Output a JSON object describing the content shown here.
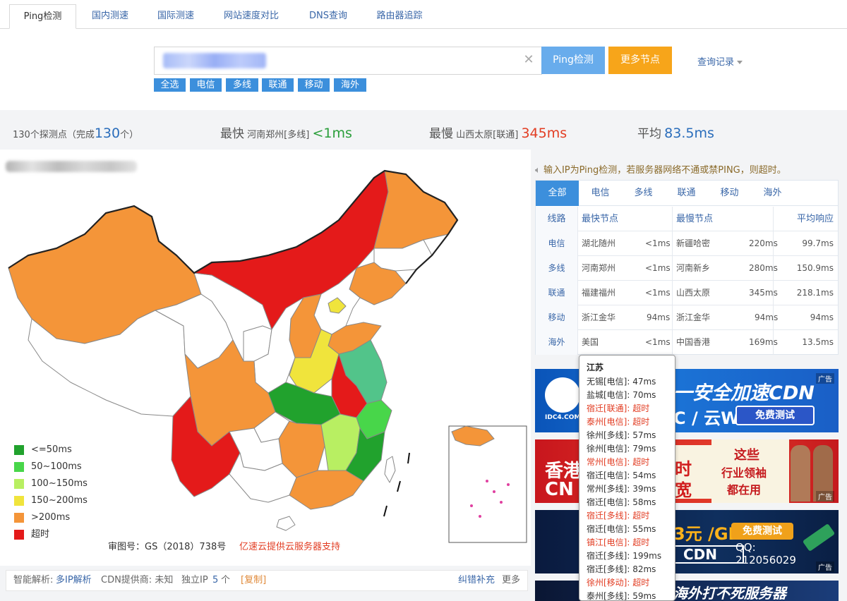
{
  "tabs": [
    "Ping检测",
    "国内测速",
    "国际测速",
    "网站速度对比",
    "DNS查询",
    "路由器追踪"
  ],
  "search": {
    "clear_icon": "close-icon"
  },
  "buttons": {
    "ping": "Ping检测",
    "more_nodes": "更多节点",
    "history": "查询记录"
  },
  "filter_chips": [
    "全选",
    "电信",
    "多线",
    "联通",
    "移动",
    "海外"
  ],
  "summary": {
    "prefix": "130个探测点（完成",
    "count": "130",
    "suffix": "个）",
    "fastest_label": "最快",
    "fastest_node": "河南郑州[多线]",
    "fastest_value": "<1ms",
    "slowest_label": "最慢",
    "slowest_node": "山西太原[联通]",
    "slowest_value": "345ms",
    "average_label": "平均",
    "average_value": "83.5ms"
  },
  "legend": [
    {
      "label": "<=50ms",
      "color": "#21a22d"
    },
    {
      "label": "50~100ms",
      "color": "#48d64a"
    },
    {
      "label": "100~150ms",
      "color": "#b8ef62"
    },
    {
      "label": "150~200ms",
      "color": "#f0e43c"
    },
    {
      "label": ">200ms",
      "color": "#f49539"
    },
    {
      "label": "超时",
      "color": "#e41a1a"
    }
  ],
  "map_footer": {
    "approval": "审图号：GS（2018）738号",
    "sponsor": "亿速云提供云服务器支持"
  },
  "info_bar": {
    "dns_label": "智能解析:",
    "dns_value": "多IP解析",
    "cdn_label": "CDN提供商: 未知",
    "ip_label": "独立IP",
    "ip_count": "5",
    "ip_unit": "个",
    "copy": "[复制]",
    "correct": "纠错补充",
    "more": "更多"
  },
  "notice": "输入IP为Ping检测，若服务器网络不通或禁PING，则超时。",
  "result_tabs": [
    "全部",
    "电信",
    "多线",
    "联通",
    "移动",
    "海外"
  ],
  "result_header": {
    "line": "线路",
    "fastest": "最快节点",
    "slowest": "最慢节点",
    "avg": "平均响应"
  },
  "result_rows": [
    {
      "line": "电信",
      "fast_node": "湖北随州",
      "fast_val": "<1ms",
      "slow_node": "新疆哈密",
      "slow_val": "220ms",
      "avg": "99.7ms"
    },
    {
      "line": "多线",
      "fast_node": "河南郑州",
      "fast_val": "<1ms",
      "slow_node": "河南新乡",
      "slow_val": "280ms",
      "avg": "150.9ms"
    },
    {
      "line": "联通",
      "fast_node": "福建福州",
      "fast_val": "<1ms",
      "slow_node": "山西太原",
      "slow_val": "345ms",
      "avg": "218.1ms"
    },
    {
      "line": "移动",
      "fast_node": "浙江金华",
      "fast_val": "94ms",
      "slow_node": "浙江金华",
      "slow_val": "94ms",
      "avg": "94ms"
    },
    {
      "line": "海外",
      "fast_node": "美国",
      "fast_val": "<1ms",
      "slow_node": "中国香港",
      "slow_val": "169ms",
      "avg": "13.5ms"
    }
  ],
  "ads": {
    "ad1": "一安全加速CDN",
    "ad1b": "C / 云WAF",
    "ad1c": "免费测试",
    "ad1_logo": "IDC4.COM",
    "ad2a": "香港",
    "ad2b": "CN",
    "ad2c": "时",
    "ad2d": "宽",
    "ad2e": "这些",
    "ad2f": "行业领袖",
    "ad2g": "都在用",
    "ad3a": "3元 /GB",
    "ad3b": "CDN",
    "ad3c": "免费测试",
    "ad3d": "QQ:",
    "ad3e": "212056029",
    "ad4": "海外打不死服务器",
    "badge": "广告"
  },
  "tooltip": {
    "title": "江苏",
    "rows": [
      {
        "text": "无锡[电信]:  47ms",
        "timeout": false
      },
      {
        "text": "盐城[电信]:  70ms",
        "timeout": false
      },
      {
        "text": "宿迁[联通]:  超时",
        "timeout": true
      },
      {
        "text": "泰州[电信]:  超时",
        "timeout": true
      },
      {
        "text": "徐州[多线]:  57ms",
        "timeout": false
      },
      {
        "text": "徐州[电信]:  79ms",
        "timeout": false
      },
      {
        "text": "常州[电信]:  超时",
        "timeout": true
      },
      {
        "text": "宿迁[电信]:  54ms",
        "timeout": false
      },
      {
        "text": "常州[多线]:  39ms",
        "timeout": false
      },
      {
        "text": "宿迁[电信]:  58ms",
        "timeout": false
      },
      {
        "text": "宿迁[多线]:  超时",
        "timeout": true
      },
      {
        "text": "宿迁[电信]:  55ms",
        "timeout": false
      },
      {
        "text": "镇江[电信]:  超时",
        "timeout": true
      },
      {
        "text": "宿迁[多线]:  199ms",
        "timeout": false
      },
      {
        "text": "宿迁[多线]:  82ms",
        "timeout": false
      },
      {
        "text": "徐州[移动]:  超时",
        "timeout": true
      },
      {
        "text": "泰州[多线]:  59ms",
        "timeout": false
      }
    ]
  }
}
